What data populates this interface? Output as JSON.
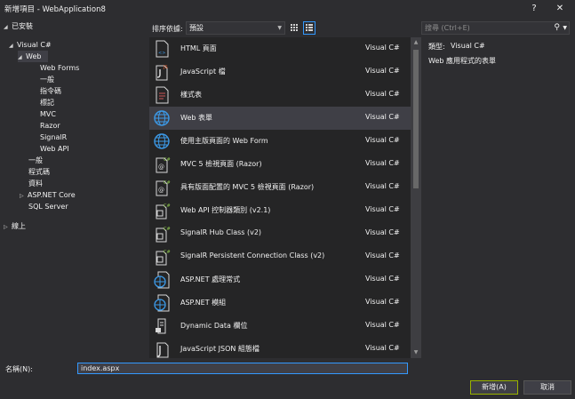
{
  "window": {
    "title": "新增項目 - WebApplication8",
    "help_glyph": "?",
    "close_glyph": "✕"
  },
  "tree": {
    "installed": "已安裝",
    "visual_csharp": "Visual C#",
    "web": "Web",
    "web_forms": "Web Forms",
    "general": "一般",
    "directives": "指令碼",
    "markup": "標記",
    "mvc": "MVC",
    "razor": "Razor",
    "signalr": "SignalR",
    "web_api": "Web API",
    "general2": "一般",
    "code": "程式碼",
    "data": "資料",
    "aspnet_core": "ASP.NET Core",
    "sql_server": "SQL Server",
    "online": "線上"
  },
  "toolbar": {
    "sort_label": "排序依據:",
    "sort_value": "預設",
    "search_placeholder": "搜尋 (Ctrl+E)",
    "search_icon": "search-icon"
  },
  "templates": [
    {
      "name": "HTML 頁面",
      "lang": "Visual C#",
      "icon": "html-page-icon"
    },
    {
      "name": "JavaScript 檔",
      "lang": "Visual C#",
      "icon": "javascript-file-icon"
    },
    {
      "name": "樣式表",
      "lang": "Visual C#",
      "icon": "stylesheet-icon"
    },
    {
      "name": "Web 表單",
      "lang": "Visual C#",
      "icon": "web-form-icon",
      "selected": true
    },
    {
      "name": "使用主版頁面的 Web Form",
      "lang": "Visual C#",
      "icon": "web-form-icon"
    },
    {
      "name": "MVC 5 檢視頁面 (Razor)",
      "lang": "Visual C#",
      "icon": "razor-view-icon"
    },
    {
      "name": "具有版面配置的 MVC 5 檢視頁面 (Razor)",
      "lang": "Visual C#",
      "icon": "razor-view-icon"
    },
    {
      "name": "Web API 控制器類別 (v2.1)",
      "lang": "Visual C#",
      "icon": "class-file-icon"
    },
    {
      "name": "SignalR Hub Class (v2)",
      "lang": "Visual C#",
      "icon": "class-file-icon"
    },
    {
      "name": "SignalR Persistent Connection Class (v2)",
      "lang": "Visual C#",
      "icon": "class-file-icon"
    },
    {
      "name": "ASP.NET 處理常式",
      "lang": "Visual C#",
      "icon": "globe-file-icon"
    },
    {
      "name": "ASP.NET 模組",
      "lang": "Visual C#",
      "icon": "globe-file-icon"
    },
    {
      "name": "Dynamic Data 欄位",
      "lang": "Visual C#",
      "icon": "dynamic-data-icon"
    },
    {
      "name": "JavaScript JSON 組態檔",
      "lang": "Visual C#",
      "icon": "json-file-icon"
    }
  ],
  "details": {
    "type_label": "類型:",
    "type_value": "Visual C#",
    "description": "Web 應用程式的表單"
  },
  "footer": {
    "name_label": "名稱(N):",
    "name_value": "index.aspx",
    "add_button": "新增(A)",
    "cancel_button": "取消"
  },
  "colors": {
    "background": "#2d2d30",
    "list_background": "#252526",
    "selection": "#3f3f46",
    "accent": "#3399ff",
    "globe_blue": "#3c9ae8",
    "primary_button_border": "#9ab300"
  }
}
